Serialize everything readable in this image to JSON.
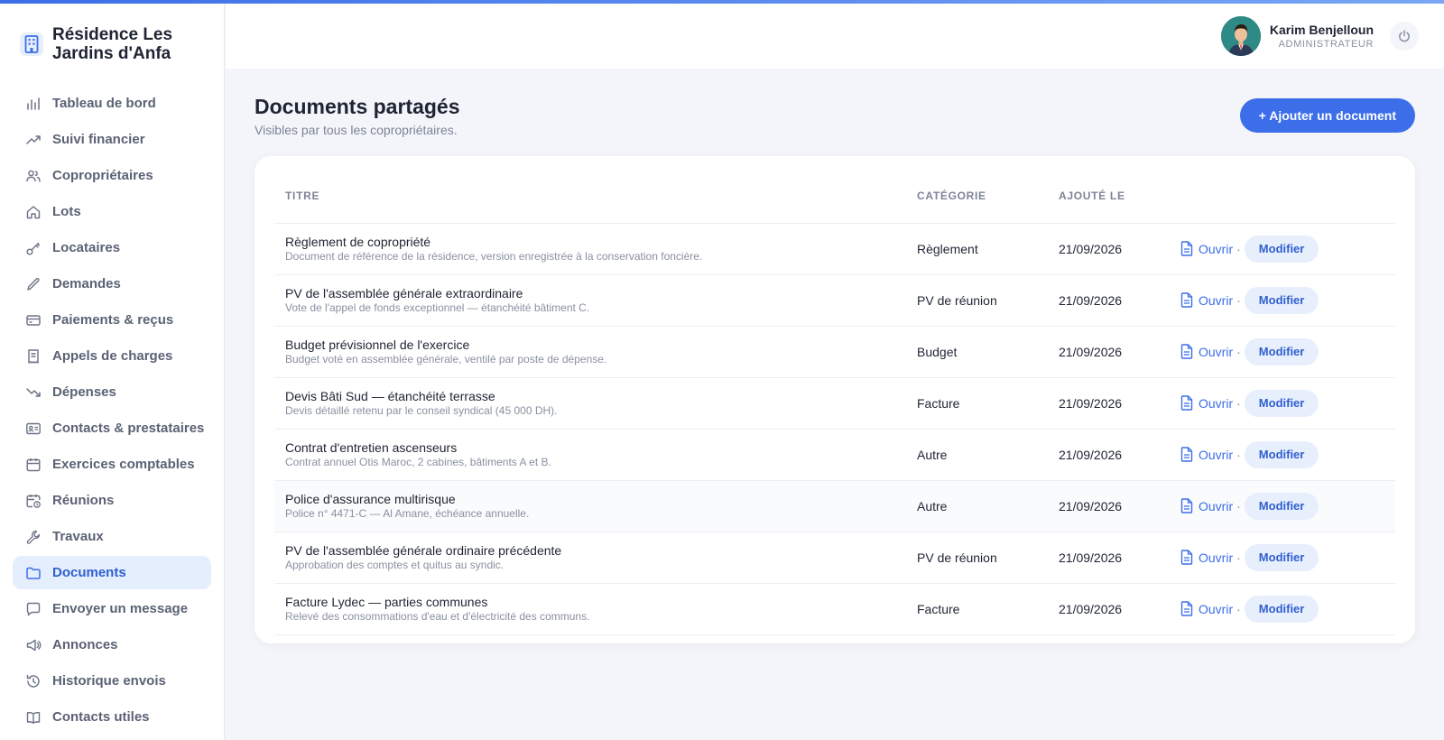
{
  "app": {
    "name": "Résidence Les Jardins d'Anfa",
    "accent": "#3b6ee8"
  },
  "sidebar": {
    "items": [
      {
        "label": "Tableau de bord",
        "icon": "bar-chart-icon"
      },
      {
        "label": "Suivi financier",
        "icon": "trending-up-icon"
      },
      {
        "label": "Copropriétaires",
        "icon": "users-icon"
      },
      {
        "label": "Lots",
        "icon": "home-icon"
      },
      {
        "label": "Locataires",
        "icon": "key-icon"
      },
      {
        "label": "Demandes",
        "icon": "pencil-icon"
      },
      {
        "label": "Paiements & reçus",
        "icon": "credit-card-icon"
      },
      {
        "label": "Appels de charges",
        "icon": "receipt-icon"
      },
      {
        "label": "Dépenses",
        "icon": "trending-down-icon"
      },
      {
        "label": "Contacts & prestataires",
        "icon": "contact-card-icon"
      },
      {
        "label": "Exercices comptables",
        "icon": "calendar-icon"
      },
      {
        "label": "Réunions",
        "icon": "calendar-clock-icon"
      },
      {
        "label": "Travaux",
        "icon": "wrench-icon"
      },
      {
        "label": "Documents",
        "icon": "folder-icon",
        "active": true
      },
      {
        "label": "Envoyer un message",
        "icon": "message-icon"
      },
      {
        "label": "Annonces",
        "icon": "megaphone-icon"
      },
      {
        "label": "Historique envois",
        "icon": "history-icon"
      },
      {
        "label": "Contacts utiles",
        "icon": "book-icon"
      }
    ]
  },
  "header": {
    "user_name": "Karim Benjelloun",
    "user_role": "ADMINISTRATEUR"
  },
  "main": {
    "title": "Documents partagés",
    "subtitle": "Visibles par tous les copropriétaires.",
    "add_button": "+ Ajouter un document",
    "table": {
      "columns": [
        "TITRE",
        "CATÉGORIE",
        "AJOUTÉ LE",
        ""
      ],
      "open_label": "Ouvrir",
      "separator": "·",
      "edit_label": "Modifier",
      "rows": [
        {
          "title": "Règlement de copropriété",
          "desc": "Document de référence de la résidence, version enregistrée à la conservation foncière.",
          "category": "Règlement",
          "date": "21/09/2026"
        },
        {
          "title": "PV de l'assemblée générale extraordinaire",
          "desc": "Vote de l'appel de fonds exceptionnel — étanchéité bâtiment C.",
          "category": "PV de réunion",
          "date": "21/09/2026"
        },
        {
          "title": "Budget prévisionnel de l'exercice",
          "desc": "Budget voté en assemblée générale, ventilé par poste de dépense.",
          "category": "Budget",
          "date": "21/09/2026"
        },
        {
          "title": "Devis Bâti Sud — étanchéité terrasse",
          "desc": "Devis détaillé retenu par le conseil syndical (45 000 DH).",
          "category": "Facture",
          "date": "21/09/2026"
        },
        {
          "title": "Contrat d'entretien ascenseurs",
          "desc": "Contrat annuel Otis Maroc, 2 cabines, bâtiments A et B.",
          "category": "Autre",
          "date": "21/09/2026"
        },
        {
          "title": "Police d'assurance multirisque",
          "desc": "Police n° 4471-C — Al Amane, échéance annuelle.",
          "category": "Autre",
          "date": "21/09/2026"
        },
        {
          "title": "PV de l'assemblée générale ordinaire précédente",
          "desc": "Approbation des comptes et quitus au syndic.",
          "category": "PV de réunion",
          "date": "21/09/2026"
        },
        {
          "title": "Facture Lydec — parties communes",
          "desc": "Relevé des consommations d'eau et d'électricité des communs.",
          "category": "Facture",
          "date": "21/09/2026"
        }
      ]
    }
  }
}
